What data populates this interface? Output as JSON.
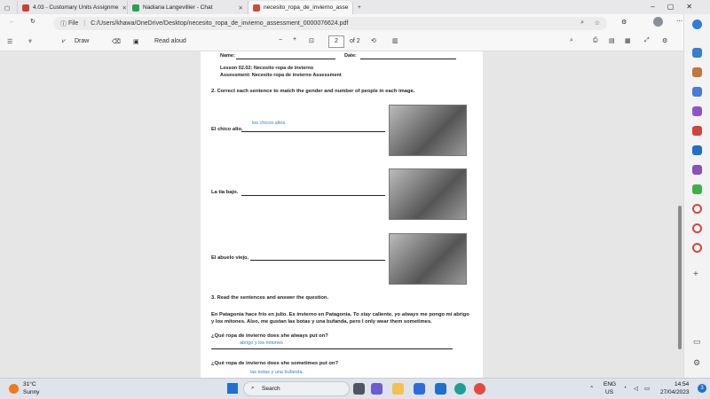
{
  "tabs": [
    {
      "label": "4.03 - Customary Units Assignme",
      "color": "#d23b3b"
    },
    {
      "label": "Nadiana Langevillier - Chat",
      "color": "#2e9e57"
    },
    {
      "label": "necesito_ropa_de_invierno_asse",
      "color": "#d04a3a"
    }
  ],
  "address": {
    "prefix": "File",
    "url": "C:/Users/khawa/OneDrive/Desktop/necesito_ropa_de_invierno_assessment_0000076624.pdf"
  },
  "toolbar": {
    "draw": "Draw",
    "read_aloud": "Read aloud",
    "page_current": "2",
    "page_total": "of 2"
  },
  "doc": {
    "name_label": "Name:",
    "date_label": "Date:",
    "lesson": "Lesson 02.02: Necesito ropa de invierno",
    "assessment": "Assessment: Necesito ropa de invierno Assessment",
    "q2": "2. Correct each sentence to match the gender and number of people in each image.",
    "s1": "El chico alto.",
    "a1": "los chicos altos.",
    "s2": "La tía bajo.",
    "s3": "El abuelo viejo.",
    "q3": "3.  Read the sentences and answer the question.",
    "para_a": "En Patagonia hace frío en julio. Es invierno en Patagonia.",
    "para_em1": "To stay",
    "para_b": "caliente, yo",
    "para_em2": "always",
    "para_c": "me pongo mi abrigo y los mitones. Also, me gustan las botas y una bufanda, pero I only wear them sometimes.",
    "qa": "¿Qué ropa de invierno does she always put on?",
    "aa": "abrigo y los mitones",
    "qb": "¿Qué ropa de invierno does she sometimes put on?",
    "ab": "las botas y una bufanda."
  },
  "taskbar": {
    "temp": "31°C",
    "weather": "Sunny",
    "search": "Search",
    "lang1": "ENG",
    "lang2": "US",
    "time": "14:54",
    "date": "27/04/2023",
    "badge": "3"
  }
}
